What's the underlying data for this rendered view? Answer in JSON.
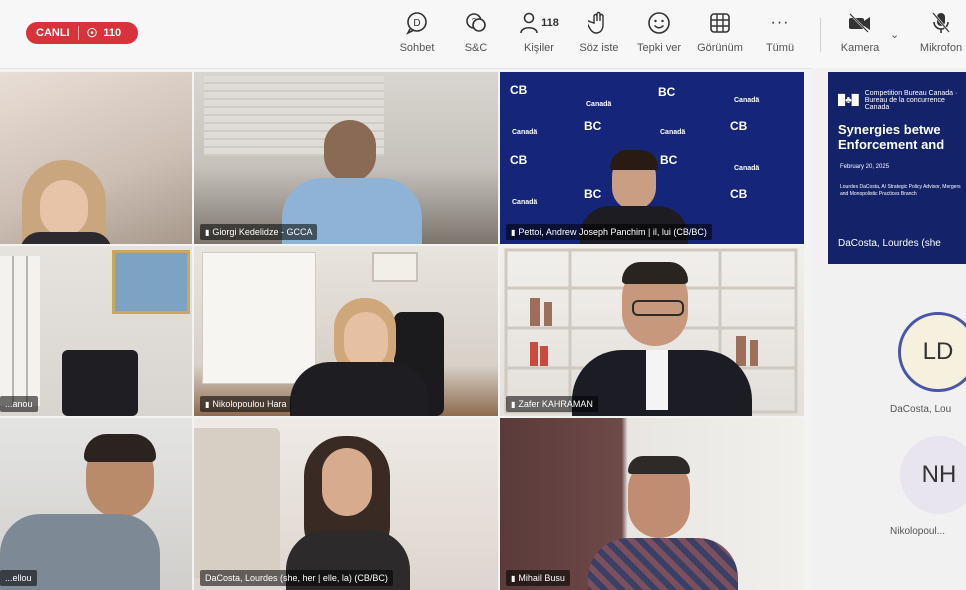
{
  "header": {
    "live_label": "CANLI",
    "viewer_count": "110",
    "buttons": [
      {
        "label": "Sohbet",
        "icon": "chat-icon"
      },
      {
        "label": "S&C",
        "icon": "qa-icon"
      },
      {
        "label": "Kişiler",
        "icon": "people-icon",
        "count": "118"
      },
      {
        "label": "Söz iste",
        "icon": "raise-hand-icon"
      },
      {
        "label": "Tepki ver",
        "icon": "reaction-icon"
      },
      {
        "label": "Görünüm",
        "icon": "view-grid-icon"
      },
      {
        "label": "Tümü",
        "icon": "more-icon"
      },
      {
        "label": "Kamera",
        "icon": "camera-off-icon"
      },
      {
        "label": "Mikrofon",
        "icon": "mic-off-icon"
      }
    ]
  },
  "participants": [
    {
      "name": ""
    },
    {
      "name": "Giorgi Kedelidze - GCCA"
    },
    {
      "name": "Pettoi, Andrew Joseph Panchim | il, lui (CB/BC)"
    },
    {
      "name": "...anou"
    },
    {
      "name": "Nikolopoulou Hara"
    },
    {
      "name": "Zafer KAHRAMAN"
    },
    {
      "name": "...ellou"
    },
    {
      "name": "DaCosta, Lourdes (she, her | elle, la) (CB/BC)"
    },
    {
      "name": "Mihail Busu"
    }
  ],
  "slide": {
    "org_lines": "Competition Bureau Canada · Bureau de la concurrence Canada",
    "title_line1": "Synergies betwe",
    "title_line2": "Enforcement and",
    "date": "February 20, 2025",
    "desc": "Lourdes DaCosta, A/ Strategic Policy Advisor, Mergers and Monopolistic Practices Branch",
    "presenter": "DaCosta, Lourdes (she"
  },
  "side_participants": [
    {
      "initials": "LD",
      "name": "DaCosta, Lou",
      "bg": "#f6f1de",
      "ring": "#4a55a8"
    },
    {
      "initials": "NH",
      "name": "Nikolopoul...",
      "bg": "#e9e5ee",
      "ring": "none"
    }
  ],
  "colors": {
    "live_red": "#d8333a",
    "slide_navy": "#14226a",
    "tile_blue": "#15267a"
  }
}
